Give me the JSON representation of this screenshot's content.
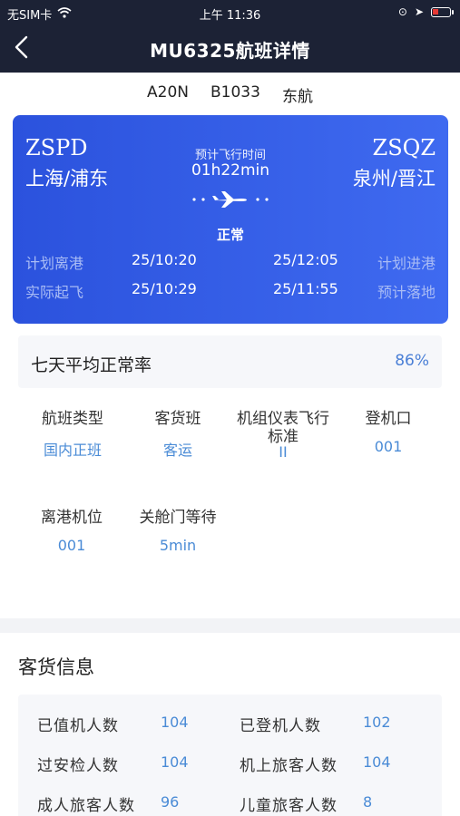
{
  "status_bar": {
    "carrier": "无SIM卡",
    "time": "上午 11:36"
  },
  "header": {
    "title": "MU6325航班详情"
  },
  "aircraft": {
    "type": "A20N",
    "reg": "B1033",
    "airline": "东航"
  },
  "flight_card": {
    "dep_code": "ZSPD",
    "dep_city": "上海/浦东",
    "arr_code": "ZSQZ",
    "arr_city": "泉州/晋江",
    "duration_label": "预计飞行时间",
    "duration": "01h22min",
    "status": "正常",
    "sched_dep_label": "计划离港",
    "sched_dep": "25/10:20",
    "sched_arr": "25/12:05",
    "sched_arr_label": "计划进港",
    "actual_dep_label": "实际起飞",
    "actual_dep": "25/10:29",
    "est_arr": "25/11:55",
    "est_arr_label": "预计落地"
  },
  "on_time": {
    "label": "七天平均正常率",
    "value": "86%"
  },
  "info": {
    "flight_type": {
      "label": "航班类型",
      "value": "国内正班"
    },
    "cargo_type": {
      "label": "客货班",
      "value": "客运"
    },
    "ils_line1": "机组仪表飞行",
    "ils_line2": "标准",
    "ils_value": "II",
    "gate": {
      "label": "登机口",
      "value": "001"
    },
    "stand": {
      "label": "离港机位",
      "value": "001"
    },
    "door_wait": {
      "label": "关舱门等待",
      "value": "5min"
    }
  },
  "pax_section": {
    "title": "客货信息",
    "checked_in": {
      "label": "已值机人数",
      "value": "104"
    },
    "boarded": {
      "label": "已登机人数",
      "value": "102"
    },
    "security": {
      "label": "过安检人数",
      "value": "104"
    },
    "onboard": {
      "label": "机上旅客人数",
      "value": "104"
    },
    "adult": {
      "label": "成人旅客人数",
      "value": "96"
    },
    "child": {
      "label": "儿童旅客人数",
      "value": "8"
    }
  },
  "colors": {
    "header_bg": "#1c2235",
    "card_blue": "#3256e6",
    "value_blue": "#4a8bd6"
  },
  "icons": [
    "wifi-icon",
    "back-arrow-icon",
    "airplane-icon",
    "location-icon",
    "battery-icon"
  ]
}
